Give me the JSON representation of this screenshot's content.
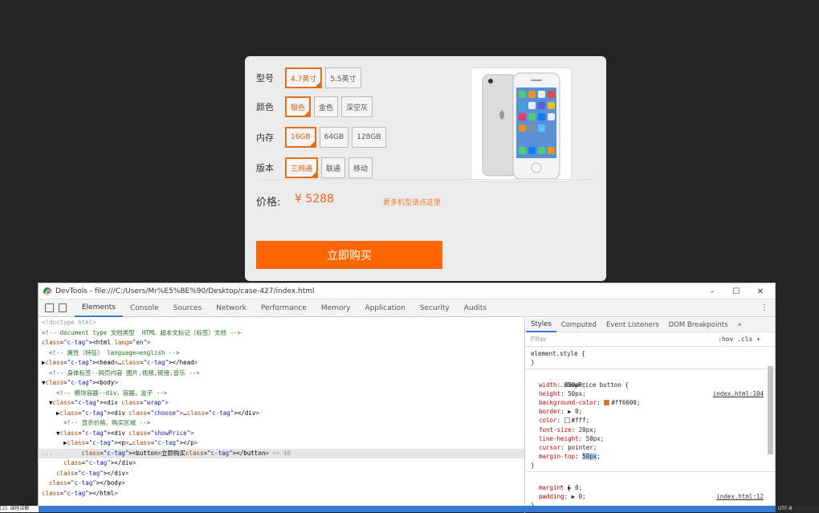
{
  "product": {
    "rows": [
      {
        "label": "型号",
        "options": [
          "4.7英寸",
          "5.5英寸"
        ],
        "selected": 0
      },
      {
        "label": "颜色",
        "options": [
          "银色",
          "金色",
          "深空灰"
        ],
        "selected": 0
      },
      {
        "label": "内存",
        "options": [
          "16GB",
          "64GB",
          "128GB"
        ],
        "selected": 0
      },
      {
        "label": "版本",
        "options": [
          "三网通",
          "联通",
          "移动"
        ],
        "selected": 0
      }
    ],
    "price_label": "价格:",
    "price_value": "¥ 5288",
    "more_link": "更多机型请点这里",
    "buy_label": "立即购买",
    "accent": "#ff6600"
  },
  "devtools": {
    "title": "DevTools - file:///C:/Users/Mr%E5%BE%90/Desktop/case-427/index.html",
    "window_controls": [
      "–",
      "☐",
      "✕"
    ],
    "tabs": [
      "Elements",
      "Console",
      "Sources",
      "Network",
      "Performance",
      "Memory",
      "Application",
      "Security",
      "Audits"
    ],
    "active_tab": "Elements",
    "more_icon": "⋮",
    "code_lines": [
      "<!doctype html>",
      "<!-- document type 文档类型  HTML 超本文标记（标签）文档 -->",
      "<html lang=\"en\">",
      "  <!-- 属性（特征） language=english -->",
      "▶<head>…</head>",
      "  <!-- 身体标签--网页内容 图片,视频,链接,音乐 -->",
      "▼<body>",
      "    <!-- 模块容器--div，容器，盒子 -->",
      "  ▼<div class=\"wrap\">",
      "    ▶<div class=\"choose\">…</div>",
      "      <!-- 显示价格，购买区域 -->",
      "    ▼<div class=\"showPrice\">",
      "      ▶<p>…</p>",
      "        <button>立即购买</button> == $0",
      "      </div>",
      "    </div>",
      "  </body>",
      "</html>"
    ],
    "gutter_dots": "...",
    "styles": {
      "tabs": [
        "Styles",
        "Computed",
        "Event Listeners",
        "DOM Breakpoints",
        "»"
      ],
      "filter": "Filter",
      "filter_right": ":hov  .cls  +",
      "element_style_1": "element.style {",
      "element_style_2": "}",
      "selector": ".showPrice button {",
      "source1": "index.html:104",
      "props": [
        "width: 330px;",
        "height: 50px;",
        "background-color: #ff6600;",
        "border: ▶ 0;",
        "color: #fff;",
        "font-size: 20px;",
        "line-height: 50px;",
        "cursor: pointer;",
        "margin-top: 50px;"
      ],
      "close": "}",
      "selector2": "* {",
      "source2": "index.html:12",
      "props2": [
        "margin: ▶ 0;",
        "padding: ▶ 0;"
      ],
      "close2": "}",
      "swatch_orange": "#ff6600",
      "swatch_white": "#ffffff"
    }
  },
  "statusbar": {
    "left": "[2]: 课程讲解",
    "right": "UTF-8"
  }
}
